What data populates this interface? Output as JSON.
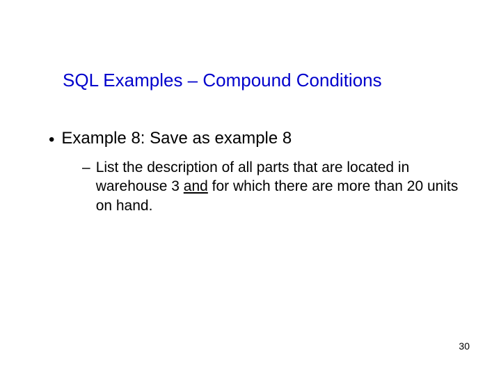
{
  "title": "SQL Examples – Compound Conditions",
  "bullet_dot": "•",
  "bullet_dash": "–",
  "example_label": "Example 8: Save as example 8",
  "sub_text_before": "List the description of all parts that are located in warehouse 3 ",
  "sub_text_underlined": "and",
  "sub_text_after": " for which there are more than 20 units on hand.",
  "page_number": "30"
}
